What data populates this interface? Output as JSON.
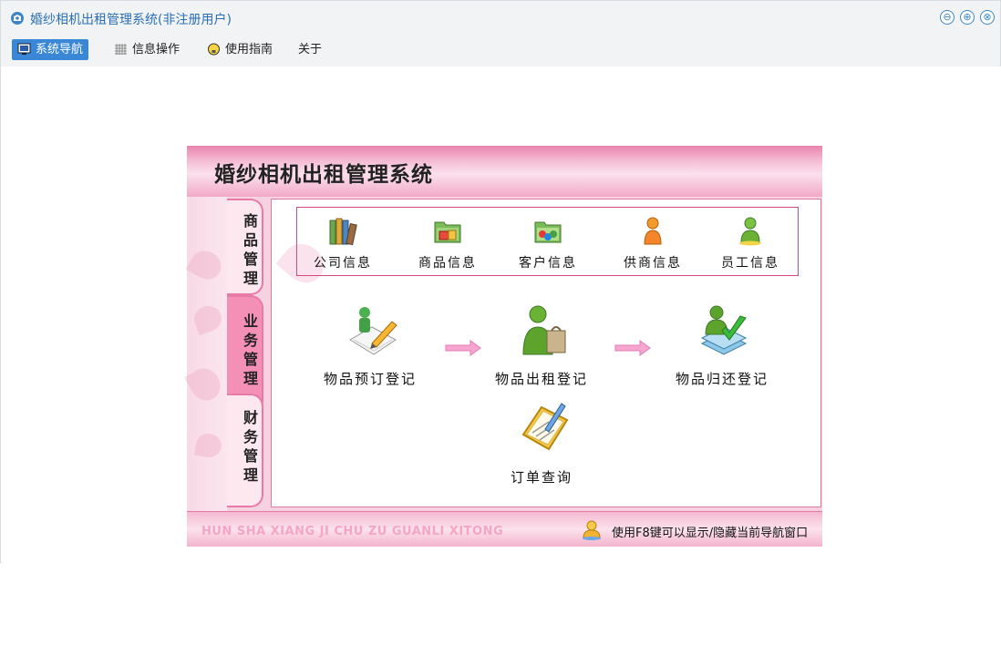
{
  "window": {
    "title": "婚纱相机出租管理系统(非注册用户)",
    "controls": {
      "minimize": "⊖",
      "maximize": "⊕",
      "close": "⊗"
    }
  },
  "menu": {
    "items": [
      {
        "label": "系统导航",
        "icon": "monitor-icon",
        "active": true
      },
      {
        "label": "信息操作",
        "icon": "grid-icon",
        "active": false
      },
      {
        "label": "使用指南",
        "icon": "lightbulb-icon",
        "active": false
      },
      {
        "label": "关于",
        "icon": "",
        "active": false
      }
    ]
  },
  "nav": {
    "title": "婚纱相机出租管理系统",
    "tabs": [
      {
        "label": "商品管理",
        "active": false
      },
      {
        "label": "业务管理",
        "active": true
      },
      {
        "label": "财务管理",
        "active": false
      }
    ],
    "info_items": [
      {
        "label": "公司信息",
        "icon": "books-icon"
      },
      {
        "label": "商品信息",
        "icon": "folder-goods-icon"
      },
      {
        "label": "客户信息",
        "icon": "folder-customers-icon"
      },
      {
        "label": "供商信息",
        "icon": "supplier-person-icon"
      },
      {
        "label": "员工信息",
        "icon": "employee-person-icon"
      }
    ],
    "flow": [
      {
        "label": "物品预订登记",
        "icon": "reservation-icon"
      },
      {
        "label": "物品出租登记",
        "icon": "rental-icon"
      },
      {
        "label": "物品归还登记",
        "icon": "return-icon"
      }
    ],
    "query": {
      "label": "订单查询",
      "icon": "order-query-icon"
    },
    "footer": {
      "pinyin": "HUN SHA XIANG JI CHU ZU GUANLI XITONG",
      "tip": "使用F8键可以显示/隐藏当前导航窗口"
    }
  },
  "colors": {
    "accent_blue": "#3a87d8",
    "title_blue": "#2a6fb6",
    "pink_border": "#e07aa2",
    "pink_header": "#e985ae"
  }
}
